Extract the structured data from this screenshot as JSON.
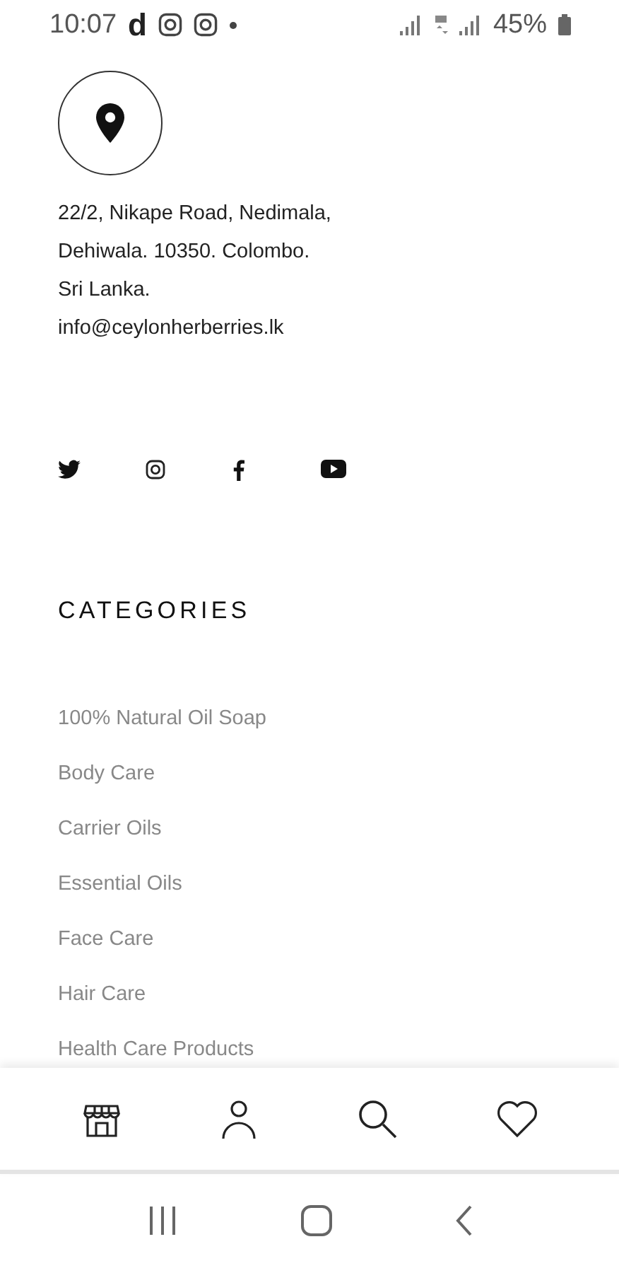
{
  "status_bar": {
    "time": "10:07",
    "notification_glyph": "d",
    "battery": "45%"
  },
  "contact": {
    "address_lines": [
      "22/2, Nikape Road, Nedimala,",
      "Dehiwala. 10350. Colombo.",
      "Sri Lanka."
    ],
    "email": "info@ceylonherberries.lk"
  },
  "social": [
    {
      "kind": "twitter"
    },
    {
      "kind": "instagram"
    },
    {
      "kind": "facebook"
    },
    {
      "kind": "youtube"
    }
  ],
  "categories": {
    "title": "CATEGORIES",
    "items": [
      "100% Natural Oil Soap",
      "Body Care",
      "Carrier Oils",
      "Essential Oils",
      "Face Care",
      "Hair Care",
      "Health Care Products"
    ]
  },
  "bottom_nav": [
    {
      "kind": "shop"
    },
    {
      "kind": "account"
    },
    {
      "kind": "search"
    },
    {
      "kind": "wishlist"
    }
  ],
  "system_nav": [
    {
      "kind": "recents"
    },
    {
      "kind": "home"
    },
    {
      "kind": "back"
    }
  ]
}
